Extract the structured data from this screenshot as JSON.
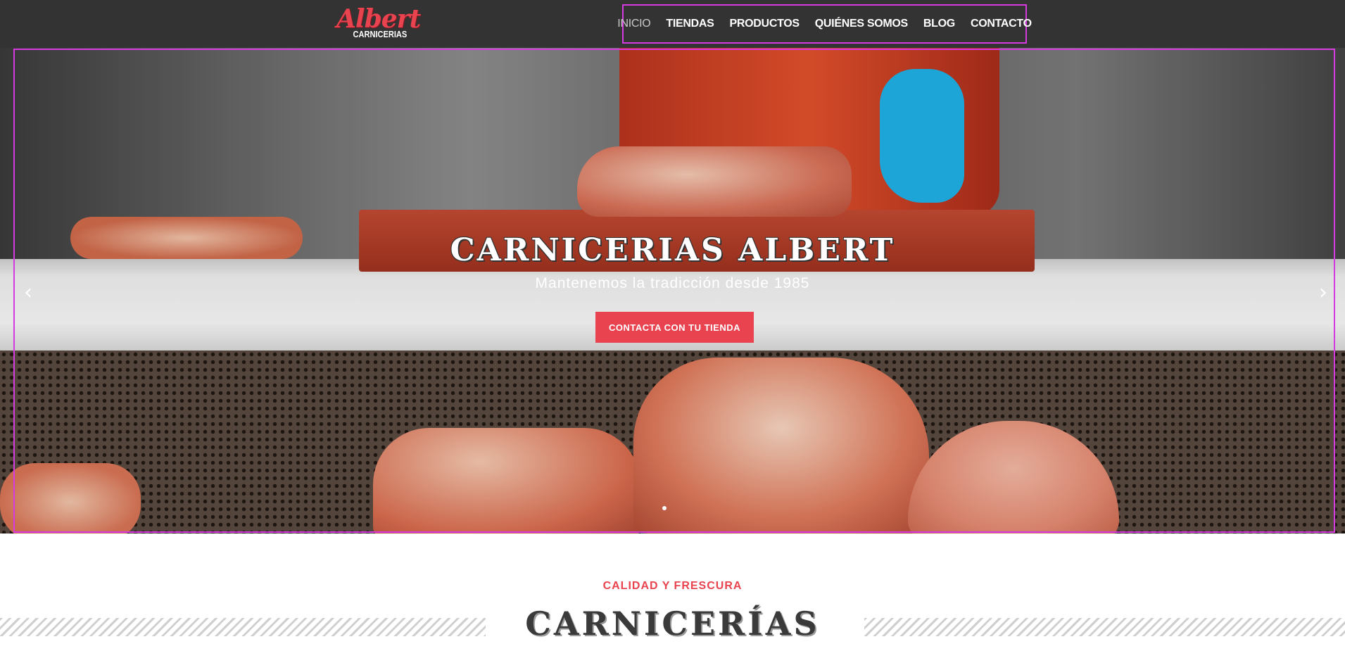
{
  "header": {
    "logo": {
      "script": "Albert",
      "sub": "CARNICERIAS"
    },
    "nav": [
      {
        "label": "INICIO",
        "active": true
      },
      {
        "label": "TIENDAS",
        "active": false
      },
      {
        "label": "PRODUCTOS",
        "active": false
      },
      {
        "label": "QUIÉNES SOMOS",
        "active": false
      },
      {
        "label": "BLOG",
        "active": false
      },
      {
        "label": "CONTACTO",
        "active": false
      }
    ]
  },
  "hero": {
    "title": "CARNICERIAS ALBERT",
    "subtitle": "Mantenemos la tradicción desde 1985",
    "button": "CONTACTA CON TU TIENDA",
    "prev_icon": "chevron-left",
    "next_icon": "chevron-right",
    "slide_count": 1
  },
  "section": {
    "kicker": "CALIDAD Y FRESCURA",
    "title": "CARNICERÍAS"
  },
  "colors": {
    "header_bg": "#333333",
    "accent": "#e8434f",
    "nav_active": "#c9c9c9",
    "title_dark": "#3a3a3a",
    "highlight_outline": "#d43adf"
  }
}
